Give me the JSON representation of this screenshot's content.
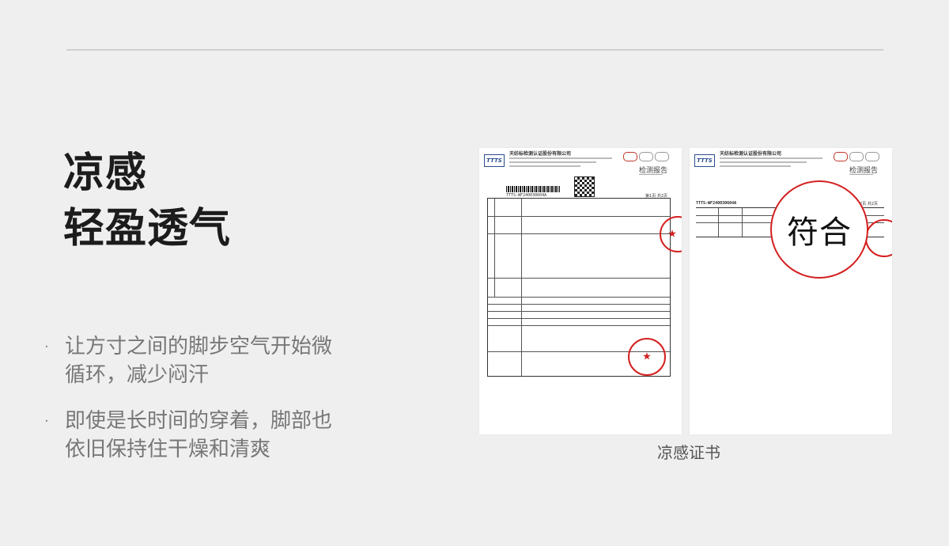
{
  "headline": [
    "凉感",
    "轻盈透气"
  ],
  "bullets": [
    {
      "lines": [
        "让方寸之间的脚步空气开始微",
        "循环，减少闷汗"
      ]
    },
    {
      "lines": [
        "即使是长时间的穿着，脚部也",
        "依旧保持住干燥和清爽"
      ]
    }
  ],
  "bullet_marker": "·",
  "certificate": {
    "logo": "TTTS",
    "org_name": "天纺标检测认证股份有限公司",
    "report_title": "检测报告",
    "report_number": "TTTS-WF240030604A",
    "page_one": "第1页 共2页",
    "page_two": "第2页 共2页",
    "stamp_text": "符合",
    "seal_star": "★"
  },
  "caption": "凉感证书",
  "colors": {
    "seal_red": "#d42020",
    "background": "#efefef"
  }
}
